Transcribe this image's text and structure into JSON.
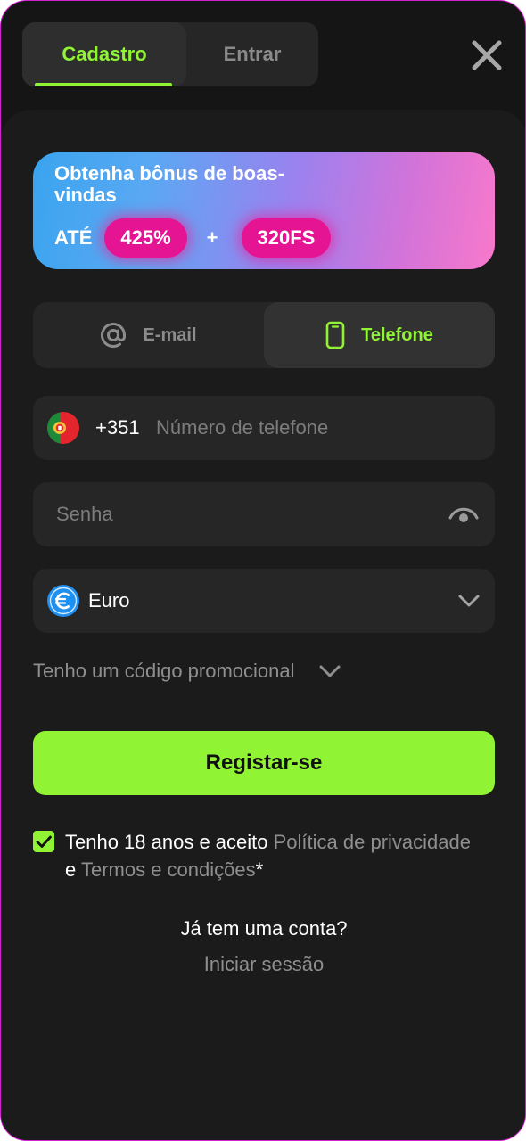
{
  "tabs": {
    "register": "Cadastro",
    "login": "Entrar"
  },
  "banner": {
    "title": "Obtenha bônus de boas-vindas",
    "prefix": "ATÉ",
    "bonus_percent": "425%",
    "plus": "+",
    "free_spins": "320FS"
  },
  "method": {
    "email_label": "E-mail",
    "phone_label": "Telefone",
    "selected": "Telefone"
  },
  "phone": {
    "country_code": "+351",
    "placeholder": "Número de telefone",
    "flag_icon": "portugal-flag-icon"
  },
  "password": {
    "placeholder": "Senha",
    "icon": "eye-icon"
  },
  "currency": {
    "label": "Euro",
    "icon": "euro-icon"
  },
  "promo": {
    "label": "Tenho um código promocional"
  },
  "register_button": "Registar-se",
  "agreement": {
    "checked": true,
    "text_start": "Tenho 18 anos e aceito ",
    "privacy_link": "Política de privacidade",
    "conjunction": " e ",
    "terms_link": "Termos e condições",
    "required_mark": "*"
  },
  "footer": {
    "question": "Já tem uma conta?",
    "login_link": "Iniciar sessão"
  },
  "colors": {
    "accent": "#90f334",
    "background": "#151515",
    "panel": "#1b1b1b",
    "bonus_pill": "#e41493"
  }
}
